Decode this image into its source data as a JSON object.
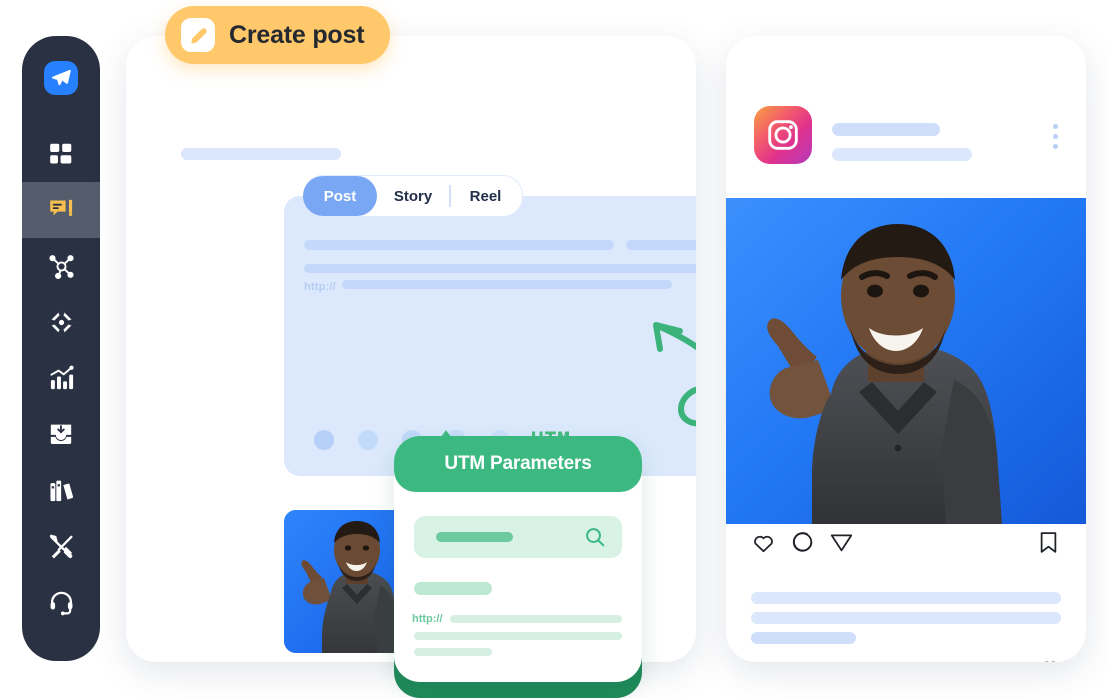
{
  "app": {
    "accent_yellow": "#ffc96b",
    "accent_green": "#3bb980",
    "accent_blue": "#7aa7f4",
    "sidebar_bg": "#2a3142"
  },
  "sidebar": {
    "logo_icon": "paper-plane-logo-icon",
    "items": [
      {
        "icon": "grid-dashboard-icon",
        "label": "Dashboard",
        "active": false
      },
      {
        "icon": "chat-bubble-pencil-icon",
        "label": "Create post",
        "active": true
      },
      {
        "icon": "network-nodes-icon",
        "label": "Channels",
        "active": false
      },
      {
        "icon": "diamond-target-icon",
        "label": "Campaigns",
        "active": false
      },
      {
        "icon": "bar-chart-growth-icon",
        "label": "Analytics",
        "active": false
      },
      {
        "icon": "inbox-download-icon",
        "label": "Inbox",
        "active": false
      },
      {
        "icon": "books-library-icon",
        "label": "Library",
        "active": false
      },
      {
        "icon": "tools-wrench-icon",
        "label": "Tools",
        "active": false
      },
      {
        "icon": "headset-support-icon",
        "label": "Support",
        "active": false
      }
    ]
  },
  "create_post_badge": {
    "label": "Create post",
    "icon": "pencil-edit-icon"
  },
  "composer": {
    "tabs": [
      {
        "label": "Post",
        "active": true
      },
      {
        "label": "Story",
        "active": false
      },
      {
        "label": "Reel",
        "active": false
      }
    ],
    "editor": {
      "link_prefix": "http://",
      "placeholder_lines": 3,
      "emoji_dots": 5
    },
    "utm_marker_label": "UTM",
    "arrow_icon": "curly-arrow-icon",
    "attachment": {
      "thumbnail_alt": "man-pointing-photo",
      "upload_box_label": ""
    }
  },
  "utm_panel": {
    "title": "UTM Parameters",
    "search_placeholder": "",
    "search_icon": "search-icon",
    "link_prefix": "http://"
  },
  "instagram_card": {
    "network_icon": "instagram-icon",
    "more_icon": "more-vertical-icon",
    "photo_alt": "man-pointing-photo",
    "actions": [
      {
        "icon": "heart-icon",
        "label": "Like"
      },
      {
        "icon": "comment-icon",
        "label": "Comment"
      },
      {
        "icon": "share-paper-plane-icon",
        "label": "Share"
      }
    ],
    "save_icon": "bookmark-icon",
    "bottom_like_icon": "heart-icon",
    "caption_lines": 3
  }
}
